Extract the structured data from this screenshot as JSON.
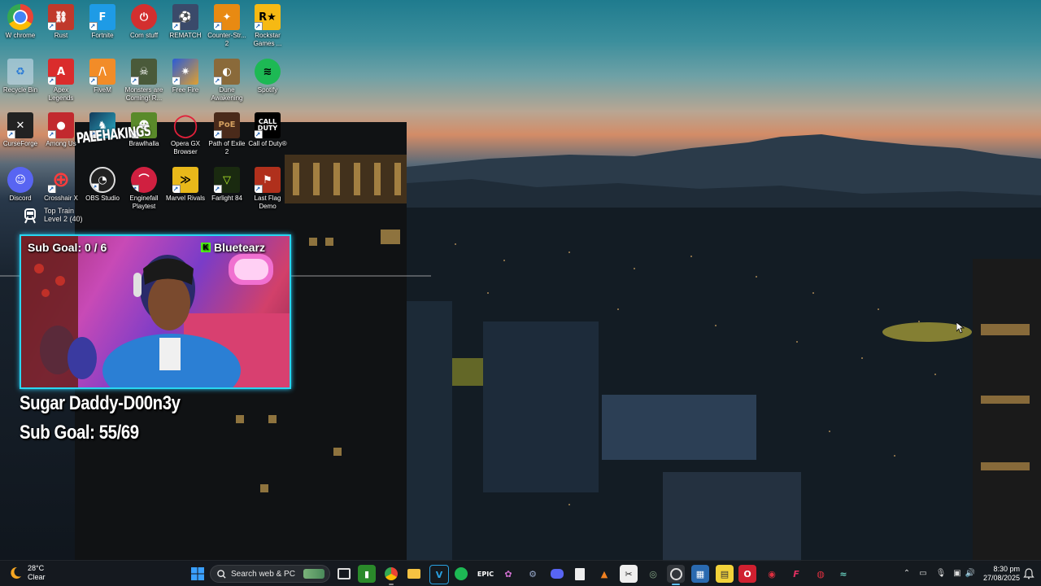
{
  "desktop": {
    "icons": [
      {
        "label": "W chrome",
        "icon": "chrome-icon"
      },
      {
        "label": "Rust",
        "icon": "rust-icon"
      },
      {
        "label": "Fortnite",
        "icon": "fortnite-icon"
      },
      {
        "label": "Com stuff",
        "icon": "power-icon"
      },
      {
        "label": "REMATCH",
        "icon": "rematch-icon"
      },
      {
        "label": "Counter-Str... 2",
        "icon": "counter-strike-icon"
      },
      {
        "label": "Rockstar Games ...",
        "icon": "rockstar-icon"
      },
      {
        "label": "Recycle Bin",
        "icon": "recycle-bin-icon"
      },
      {
        "label": "Apex Legends",
        "icon": "apex-icon"
      },
      {
        "label": "FiveM",
        "icon": "fivem-icon"
      },
      {
        "label": "Monsters are Coming! R...",
        "icon": "monsters-icon"
      },
      {
        "label": "Free Fire",
        "icon": "free-fire-icon"
      },
      {
        "label": "Dune Awakening",
        "icon": "dune-icon"
      },
      {
        "label": "Spotify",
        "icon": "spotify-icon"
      },
      {
        "label": "CurseForge",
        "icon": "curseforge-icon"
      },
      {
        "label": "Among Us",
        "icon": "among-us-icon"
      },
      {
        "label": "",
        "icon": "game-icon"
      },
      {
        "label": "Brawlhalla",
        "icon": "brawlhalla-icon"
      },
      {
        "label": "Opera GX Browser",
        "icon": "opera-gx-icon"
      },
      {
        "label": "Path of Exile 2",
        "icon": "path-of-exile-icon"
      },
      {
        "label": "Call of Duty®",
        "icon": "call-of-duty-icon"
      },
      {
        "label": "Discord",
        "icon": "discord-icon"
      },
      {
        "label": "Crosshair X",
        "icon": "crosshair-icon"
      },
      {
        "label": "OBS Studio",
        "icon": "obs-icon"
      },
      {
        "label": "Enginefall Playtest",
        "icon": "enginefall-icon"
      },
      {
        "label": "Marvel Rivals",
        "icon": "marvel-rivals-icon"
      },
      {
        "label": "Farlight 84",
        "icon": "farlight-icon"
      },
      {
        "label": "Last Flag Demo",
        "icon": "last-flag-icon"
      }
    ],
    "top_train": {
      "line1": "Top Train",
      "line2": "Level 2 (40)"
    }
  },
  "overlay": {
    "webcam_subgoal": "Sub Goal: 0 / 6",
    "webcam_name": "Bluetearz",
    "stream_watermark": "PALEHAKINGS",
    "big_name": "Sugar Daddy-D00n3y",
    "big_subgoal": "Sub Goal: 55/69"
  },
  "taskbar": {
    "weather_temp": "28°C",
    "weather_desc": "Clear",
    "search_placeholder": "Search web & PC",
    "clock_time": "8:30 pm",
    "clock_date": "27/08/2025"
  },
  "colors": {
    "overlay_border": "#29d6f0",
    "kick_green": "#53fc18",
    "taskbar_bg": "#161a20"
  }
}
